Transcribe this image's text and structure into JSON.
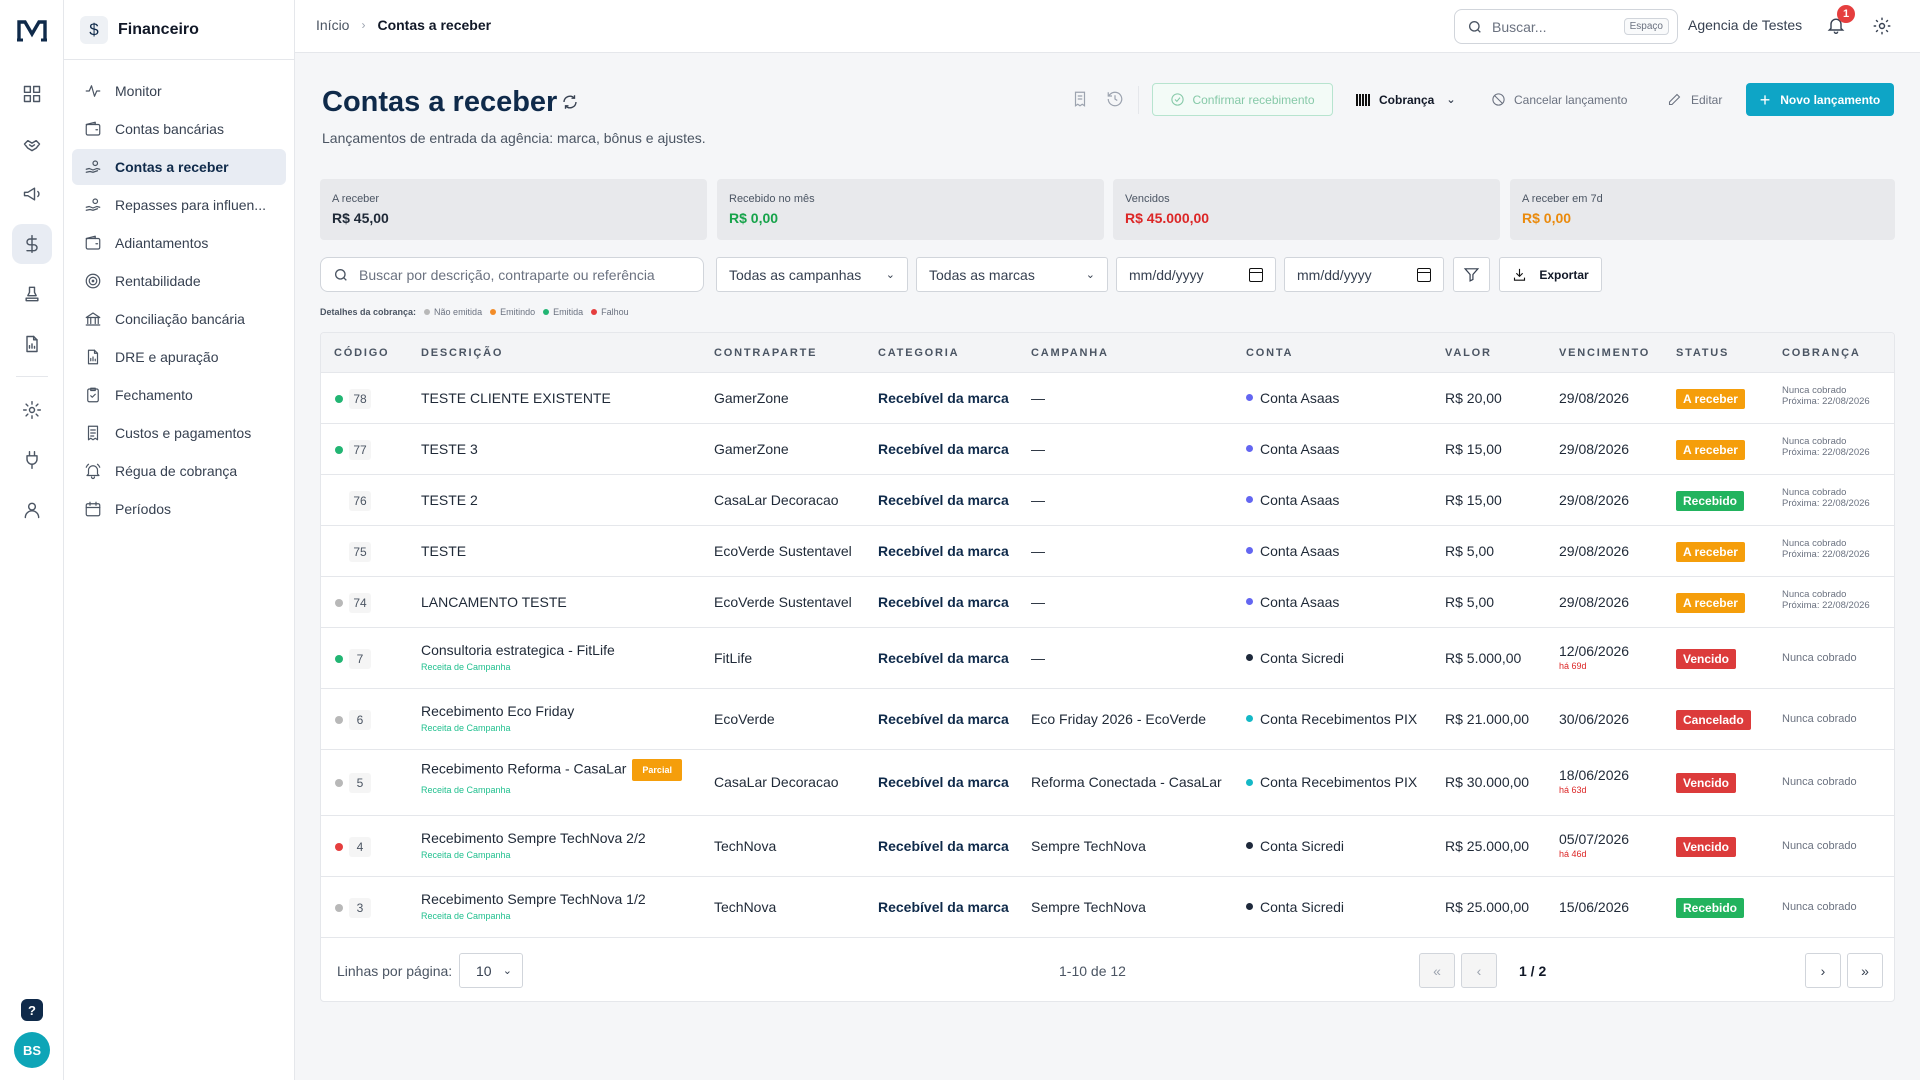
{
  "rail": {
    "logo": "M",
    "help": "?",
    "avatar": "BS"
  },
  "sidebar": {
    "title": "Financeiro",
    "items": [
      {
        "label": "Monitor",
        "icon": "activity-icon"
      },
      {
        "label": "Contas bancárias",
        "icon": "wallet-icon"
      },
      {
        "label": "Contas a receber",
        "icon": "hand-coins-icon",
        "active": true
      },
      {
        "label": "Repasses para influen...",
        "icon": "hand-coins-icon"
      },
      {
        "label": "Adiantamentos",
        "icon": "wallet-icon"
      },
      {
        "label": "Rentabilidade",
        "icon": "target-icon"
      },
      {
        "label": "Conciliação bancária",
        "icon": "bank-icon"
      },
      {
        "label": "DRE e apuração",
        "icon": "file-chart-icon"
      },
      {
        "label": "Fechamento",
        "icon": "clipboard-check-icon"
      },
      {
        "label": "Custos e pagamentos",
        "icon": "receipt-icon"
      },
      {
        "label": "Régua de cobrança",
        "icon": "bell-ring-icon"
      },
      {
        "label": "Períodos",
        "icon": "calendar-icon"
      }
    ]
  },
  "topbar": {
    "breadcrumb_home": "Início",
    "breadcrumb_separator": "›",
    "breadcrumb_current": "Contas a receber",
    "search_placeholder": "Buscar...",
    "search_shortcut": "Espaço",
    "agency": "Agencia de Testes",
    "notifications": "1"
  },
  "header": {
    "title": "Contas a receber",
    "subtitle": "Lançamentos de entrada da agência: marca, bônus e ajustes.",
    "confirm_label": "Confirmar recebimento",
    "cobranca_label": "Cobrança",
    "cancel_label": "Cancelar lançamento",
    "edit_label": "Editar",
    "new_label": "Novo lançamento"
  },
  "kpis": [
    {
      "label": "A receber",
      "value": "R$ 45,00",
      "color": "#1f2937"
    },
    {
      "label": "Recebido no mês",
      "value": "R$ 0,00",
      "color": "#16a34a"
    },
    {
      "label": "Vencidos",
      "value": "R$ 45.000,00",
      "color": "#dc2626"
    },
    {
      "label": "A receber em 7d",
      "value": "R$ 0,00",
      "color": "#ea8a0c"
    }
  ],
  "filters": {
    "search_placeholder": "Buscar por descrição, contraparte ou referência",
    "campaigns": "Todas as campanhas",
    "brands": "Todas as marcas",
    "date_from": "mm/dd/yyyy",
    "date_to": "mm/dd/yyyy",
    "export_label": "Exportar"
  },
  "legend": {
    "title": "Detalhes da cobrança:",
    "items": [
      {
        "label": "Não emitida",
        "color": "#b8b8b8"
      },
      {
        "label": "Emitindo",
        "color": "#f28c28"
      },
      {
        "label": "Emitida",
        "color": "#22b573"
      },
      {
        "label": "Falhou",
        "color": "#e53e3e"
      }
    ]
  },
  "table": {
    "columns": [
      "CÓDIGO",
      "DESCRIÇÃO",
      "CONTRAPARTE",
      "CATEGORIA",
      "CAMPANHA",
      "CONTA",
      "VALOR",
      "VENCIMENTO",
      "STATUS",
      "COBRANÇA"
    ],
    "rows": [
      {
        "dot": "#22b573",
        "code": "78",
        "desc": "TESTE CLIENTE EXISTENTE",
        "desc_sub": "",
        "partial": "",
        "party": "GamerZone",
        "category": "Recebível da marca",
        "campaign": "—",
        "account": "Conta Asaas",
        "account_color": "#6366f1",
        "value": "R$ 20,00",
        "due": "29/08/2026",
        "due_sub": "",
        "status": "A receber",
        "status_color": "#f59e0b",
        "cob1": "Nunca cobrado",
        "cob2": "Próxima: 22/08/2026"
      },
      {
        "dot": "#22b573",
        "code": "77",
        "desc": "TESTE 3",
        "desc_sub": "",
        "partial": "",
        "party": "GamerZone",
        "category": "Recebível da marca",
        "campaign": "—",
        "account": "Conta Asaas",
        "account_color": "#6366f1",
        "value": "R$ 15,00",
        "due": "29/08/2026",
        "due_sub": "",
        "status": "A receber",
        "status_color": "#f59e0b",
        "cob1": "Nunca cobrado",
        "cob2": "Próxima: 22/08/2026"
      },
      {
        "dot": "",
        "code": "76",
        "desc": "TESTE 2",
        "desc_sub": "",
        "partial": "",
        "party": "CasaLar Decoracao",
        "category": "Recebível da marca",
        "campaign": "—",
        "account": "Conta Asaas",
        "account_color": "#6366f1",
        "value": "R$ 15,00",
        "due": "29/08/2026",
        "due_sub": "",
        "status": "Recebido",
        "status_color": "#22b35e",
        "cob1": "Nunca cobrado",
        "cob2": "Próxima: 22/08/2026"
      },
      {
        "dot": "",
        "code": "75",
        "desc": "TESTE",
        "desc_sub": "",
        "partial": "",
        "party": "EcoVerde Sustentavel",
        "category": "Recebível da marca",
        "campaign": "—",
        "account": "Conta Asaas",
        "account_color": "#6366f1",
        "value": "R$ 5,00",
        "due": "29/08/2026",
        "due_sub": "",
        "status": "A receber",
        "status_color": "#f59e0b",
        "cob1": "Nunca cobrado",
        "cob2": "Próxima: 22/08/2026"
      },
      {
        "dot": "#b8b8b8",
        "code": "74",
        "desc": "LANCAMENTO TESTE",
        "desc_sub": "",
        "partial": "",
        "party": "EcoVerde Sustentavel",
        "category": "Recebível da marca",
        "campaign": "—",
        "account": "Conta Asaas",
        "account_color": "#6366f1",
        "value": "R$ 5,00",
        "due": "29/08/2026",
        "due_sub": "",
        "status": "A receber",
        "status_color": "#f59e0b",
        "cob1": "Nunca cobrado",
        "cob2": "Próxima: 22/08/2026"
      },
      {
        "dot": "#22b573",
        "code": "7",
        "desc": "Consultoria estrategica - FitLife",
        "desc_sub": "Receita de Campanha",
        "partial": "",
        "party": "FitLife",
        "category": "Recebível da marca",
        "campaign": "—",
        "account": "Conta Sicredi",
        "account_color": "#1e293b",
        "value": "R$ 5.000,00",
        "due": "12/06/2026",
        "due_sub": "há 69d",
        "status": "Vencido",
        "status_color": "#dc3b3b",
        "cob1": "Nunca cobrado",
        "cob2": ""
      },
      {
        "dot": "#b8b8b8",
        "code": "6",
        "desc": "Recebimento Eco Friday",
        "desc_sub": "Receita de Campanha",
        "partial": "",
        "party": "EcoVerde",
        "category": "Recebível da marca",
        "campaign": "Eco Friday 2026 - EcoVerde",
        "account": "Conta Recebimentos PIX",
        "account_color": "#14b8c6",
        "value": "R$ 21.000,00",
        "due": "30/06/2026",
        "due_sub": "",
        "status": "Cancelado",
        "status_color": "#dc3b3b",
        "cob1": "Nunca cobrado",
        "cob2": ""
      },
      {
        "dot": "#b8b8b8",
        "code": "5",
        "desc": "Recebimento Reforma - CasaLar",
        "desc_sub": "Receita de Campanha",
        "partial": "Parcial",
        "party": "CasaLar Decoracao",
        "category": "Recebível da marca",
        "campaign": "Reforma Conectada - CasaLar",
        "account": "Conta Recebimentos PIX",
        "account_color": "#14b8c6",
        "value": "R$ 30.000,00",
        "due": "18/06/2026",
        "due_sub": "há 63d",
        "status": "Vencido",
        "status_color": "#dc3b3b",
        "cob1": "Nunca cobrado",
        "cob2": ""
      },
      {
        "dot": "#e53e3e",
        "code": "4",
        "desc": "Recebimento Sempre TechNova 2/2",
        "desc_sub": "Receita de Campanha",
        "partial": "",
        "party": "TechNova",
        "category": "Recebível da marca",
        "campaign": "Sempre TechNova",
        "account": "Conta Sicredi",
        "account_color": "#1e293b",
        "value": "R$ 25.000,00",
        "due": "05/07/2026",
        "due_sub": "há 46d",
        "status": "Vencido",
        "status_color": "#dc3b3b",
        "cob1": "Nunca cobrado",
        "cob2": ""
      },
      {
        "dot": "#b8b8b8",
        "code": "3",
        "desc": "Recebimento Sempre TechNova 1/2",
        "desc_sub": "Receita de Campanha",
        "partial": "",
        "party": "TechNova",
        "category": "Recebível da marca",
        "campaign": "Sempre TechNova",
        "account": "Conta Sicredi",
        "account_color": "#1e293b",
        "value": "R$ 25.000,00",
        "due": "15/06/2026",
        "due_sub": "",
        "status": "Recebido",
        "status_color": "#22b35e",
        "cob1": "Nunca cobrado",
        "cob2": ""
      }
    ]
  },
  "pagination": {
    "rows_label": "Linhas por página:",
    "rows_value": "10",
    "range": "1-10 de 12",
    "page": "1 / 2",
    "first": "«",
    "prev": "‹",
    "next": "›",
    "last": "»"
  }
}
